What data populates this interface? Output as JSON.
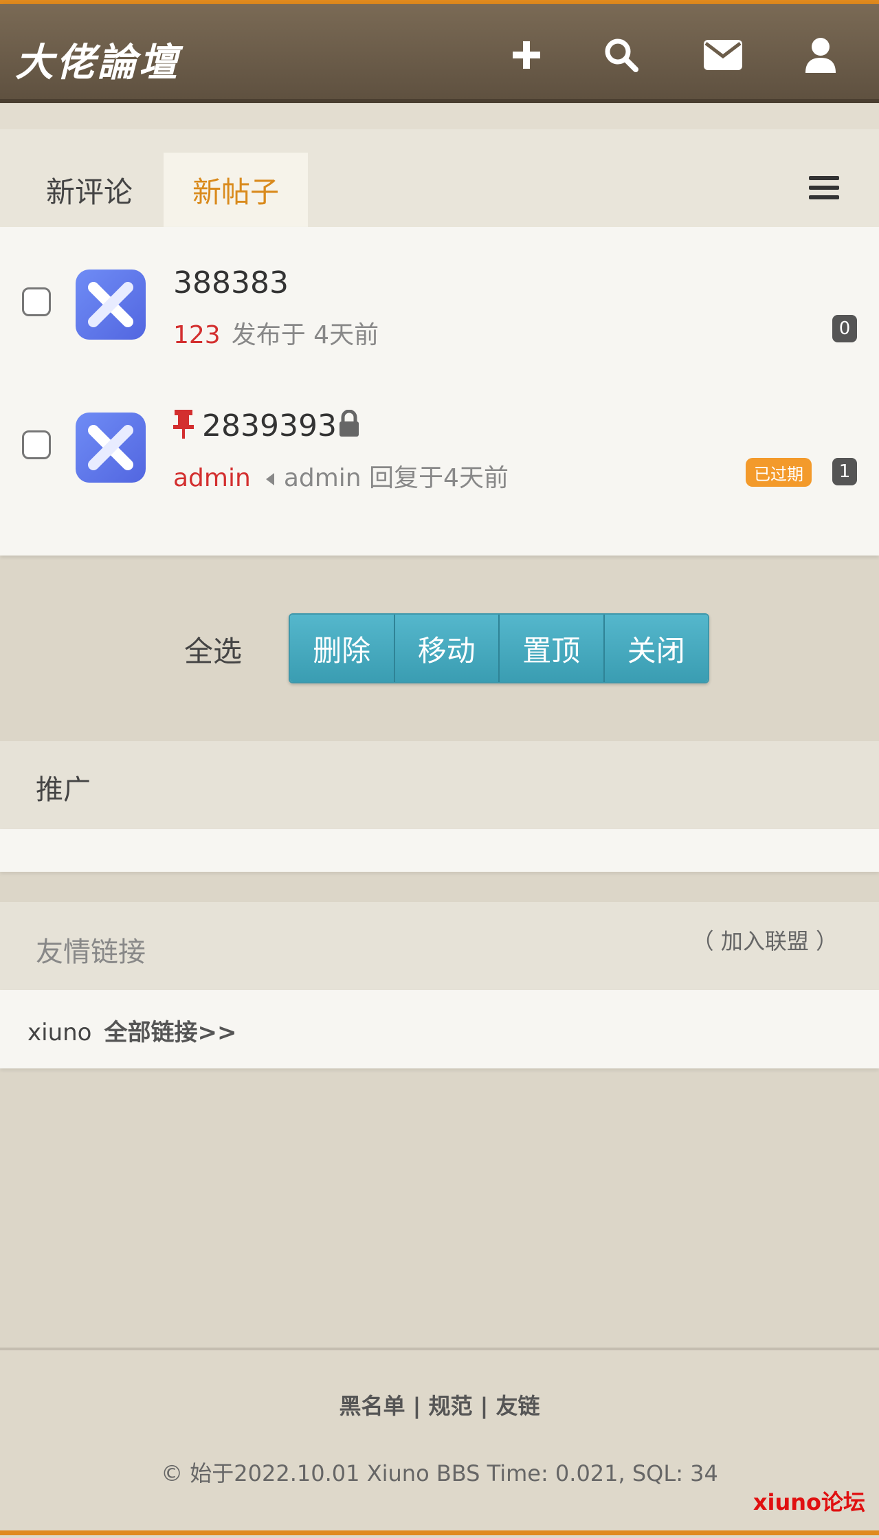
{
  "header": {
    "logo_text": "大佬論壇",
    "icons": [
      "plus-icon",
      "search-icon",
      "mail-icon",
      "user-icon"
    ]
  },
  "tabs": [
    {
      "label": "新评论",
      "active": false
    },
    {
      "label": "新帖子",
      "active": true
    }
  ],
  "threads": [
    {
      "title": "388383",
      "author": "123",
      "meta": "发布于 4天前",
      "replies": "0"
    },
    {
      "title": "2839393",
      "author": "admin",
      "meta": "admin 回复于4天前",
      "badge": "已过期",
      "replies": "1",
      "pinned": true,
      "locked": true
    }
  ],
  "actions": {
    "select_all": "全选",
    "buttons": [
      "删除",
      "移动",
      "置顶",
      "关闭"
    ]
  },
  "promo": {
    "title": "推广"
  },
  "friend_links": {
    "title": "友情链接",
    "join": "（ 加入联盟 ）",
    "link": "xiuno",
    "all_links": "全部链接>>"
  },
  "footer": {
    "links": "黑名单 | 规范 | 友链",
    "copyright": "© 始于2022.10.01 Xiuno BBS Time: 0.021, SQL: 34",
    "watermark": "xiuno论坛"
  },
  "colors": {
    "accent": "#e08a1e",
    "header": "#6c5d4a",
    "button": "#46a8bd",
    "author": "#d32f2f",
    "active_tab": "#d98a1c"
  }
}
